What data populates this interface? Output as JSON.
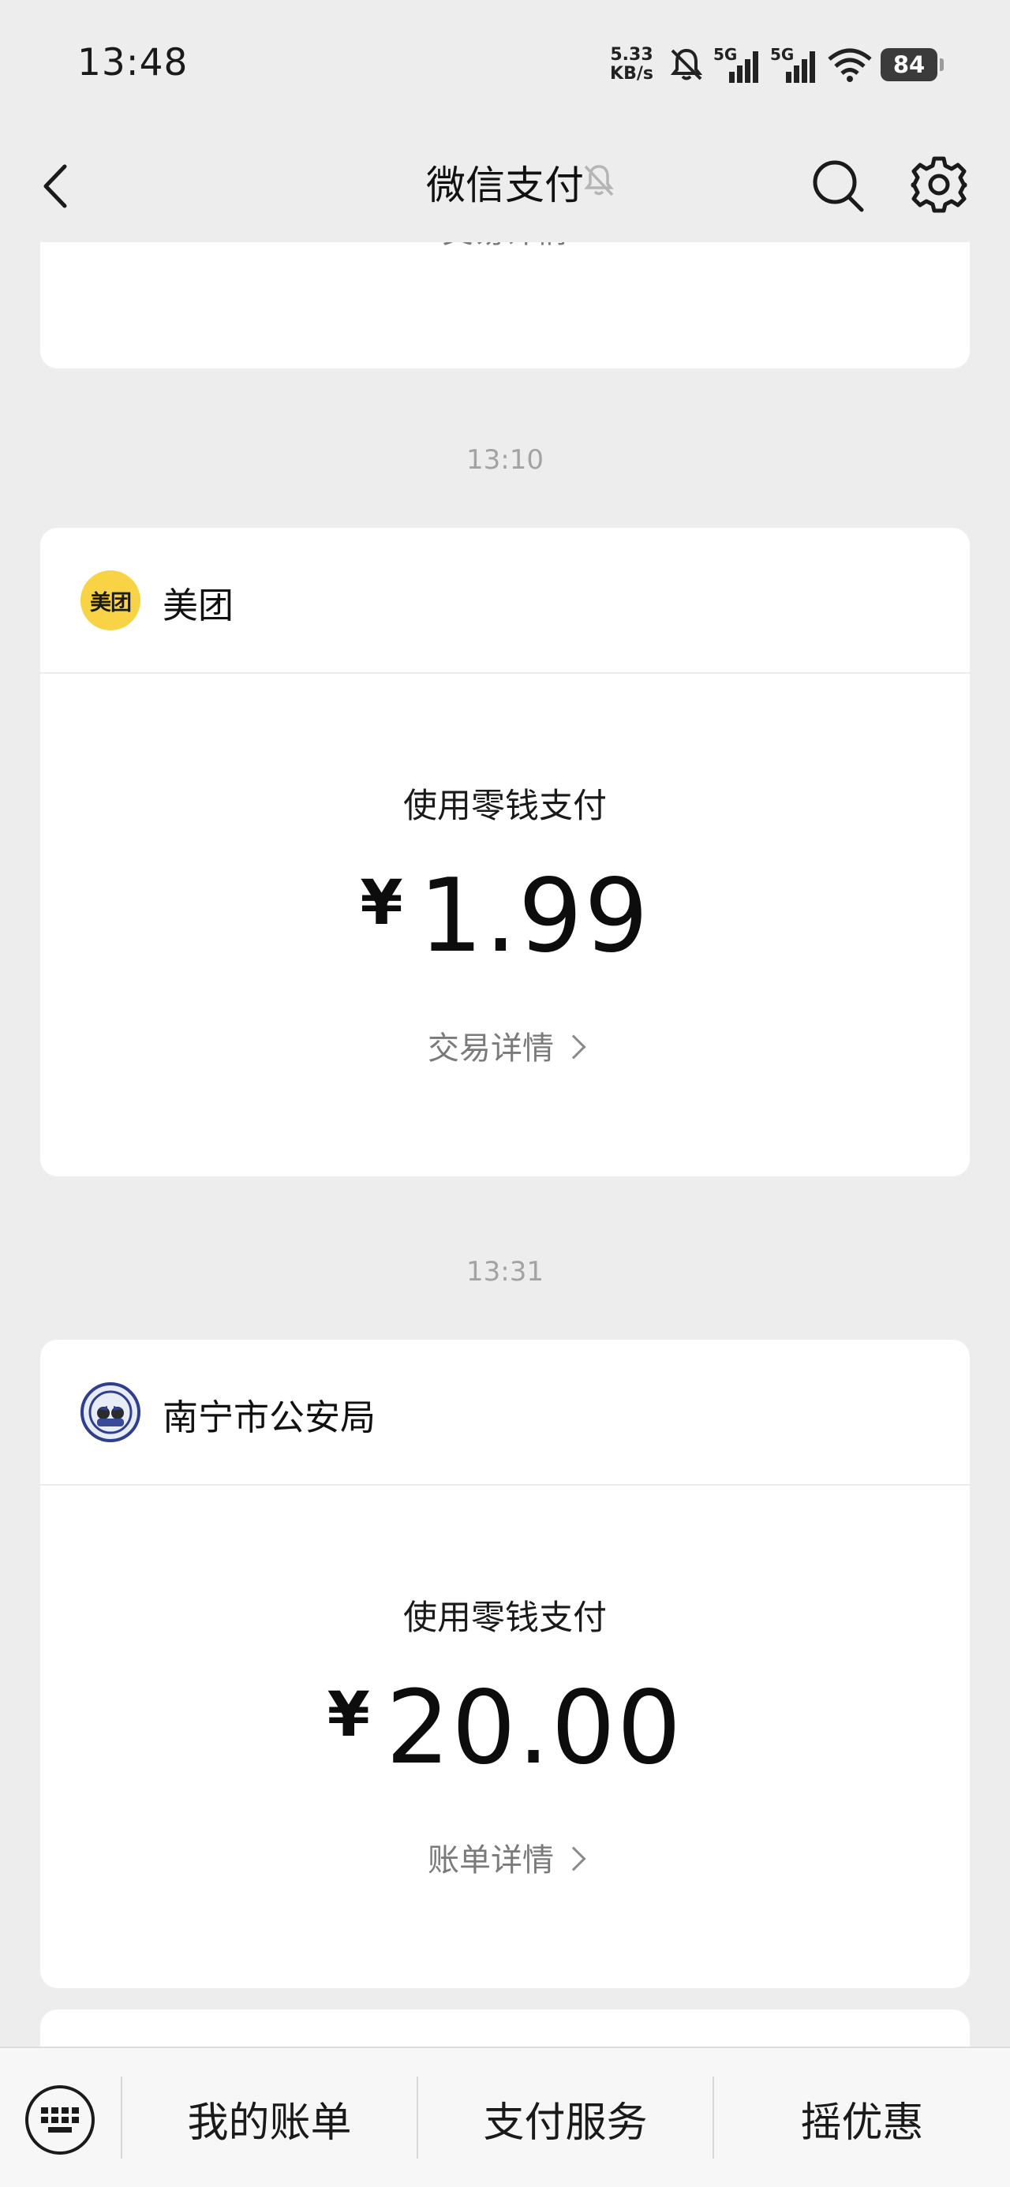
{
  "status_bar": {
    "time": "13:48",
    "net_speed_value": "5.33",
    "net_speed_unit": "KB/s",
    "sim1_label": "5G",
    "sim2_label": "5G",
    "battery": "84"
  },
  "nav": {
    "title": "微信支付"
  },
  "top_partial_card": {
    "link_label": "交易详情"
  },
  "transactions": [
    {
      "time": "13:10",
      "merchant": "美团",
      "logo_text": "美团",
      "method": "使用零钱支付",
      "currency": "¥",
      "amount": "1.99",
      "detail_label": "交易详情"
    },
    {
      "time": "13:31",
      "merchant": "南宁市公安局",
      "method": "使用零钱支付",
      "currency": "¥",
      "amount": "20.00",
      "detail_label": "账单详情"
    }
  ],
  "bottom_menu": {
    "items": [
      "我的账单",
      "支付服务",
      "摇优惠"
    ]
  },
  "colors": {
    "background": "#ededed",
    "card": "#ffffff",
    "meituan_yellow": "#f7d345",
    "muted_text": "#7a7a7a",
    "timestamp_text": "#a3a3a3"
  },
  "icons": {
    "back": "chevron-left-icon",
    "mute": "bell-off-icon",
    "search": "search-icon",
    "settings": "gear-icon",
    "keyboard": "keyboard-icon"
  }
}
